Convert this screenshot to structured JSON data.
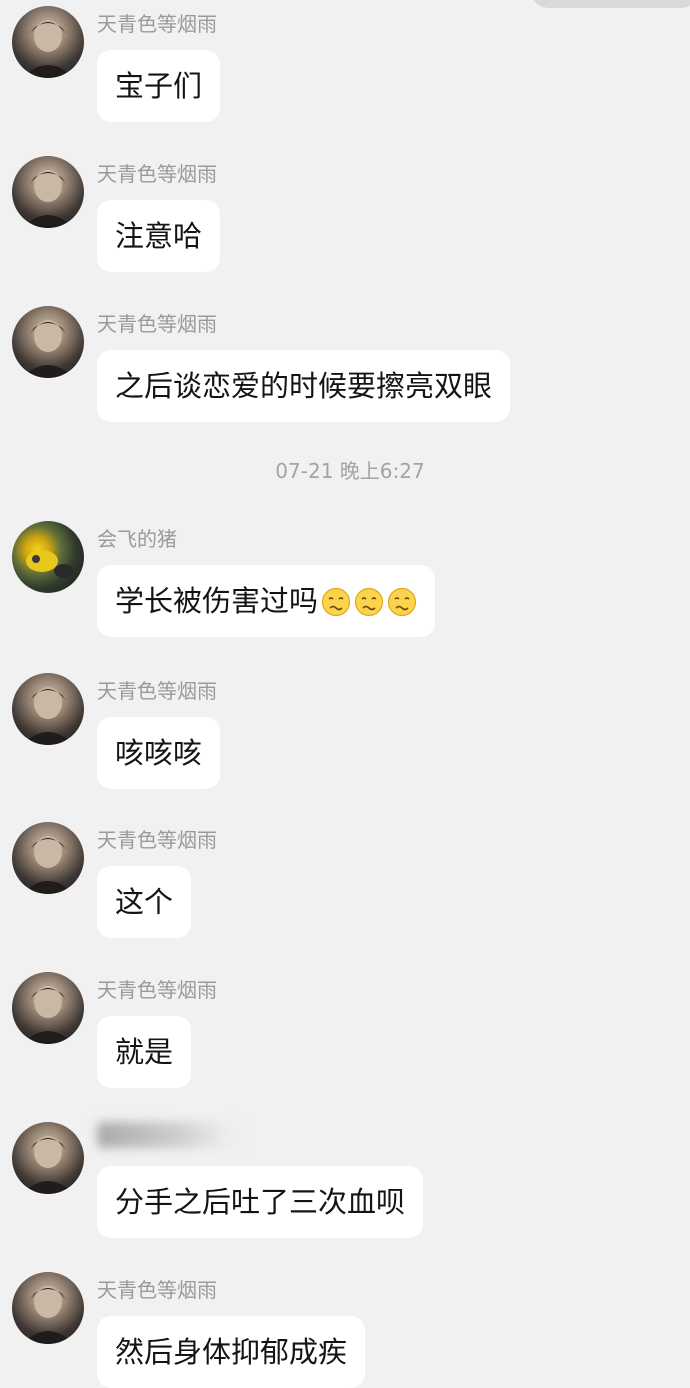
{
  "timestamp": "07-21 晚上6:27",
  "messages": [
    {
      "sender": "天青色等烟雨",
      "text": "宝子们"
    },
    {
      "sender": "天青色等烟雨",
      "text": "注意哈"
    },
    {
      "sender": "天青色等烟雨",
      "text": "之后谈恋爱的时候要擦亮双眼"
    },
    {
      "sender": "会飞的猪",
      "text": "学长被伤害过吗",
      "emojis": [
        "woozy-face-icon",
        "woozy-face-icon",
        "woozy-face-icon"
      ]
    },
    {
      "sender": "天青色等烟雨",
      "text": "咳咳咳"
    },
    {
      "sender": "天青色等烟雨",
      "text": "这个"
    },
    {
      "sender": "天青色等烟雨",
      "text": "就是"
    },
    {
      "sender": "",
      "text": "分手之后吐了三次血呗"
    },
    {
      "sender": "天青色等烟雨",
      "text": "然后身体抑郁成疾"
    }
  ]
}
